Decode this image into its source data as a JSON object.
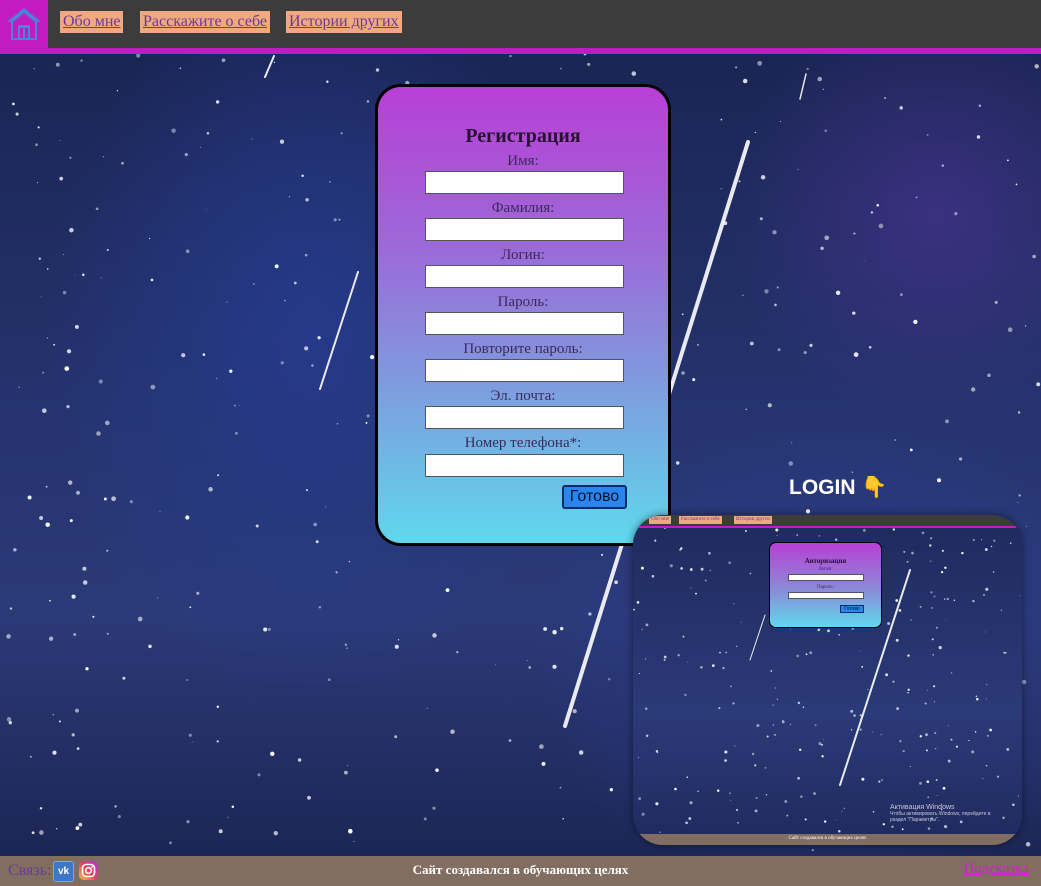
{
  "header": {
    "home_icon": "home-icon",
    "nav": [
      {
        "label": "Обо мне"
      },
      {
        "label": "Расскажите о себе"
      },
      {
        "label": "Истории других"
      }
    ],
    "accent_color": "#c21bc2"
  },
  "form": {
    "title": "Регистрация",
    "fields": [
      {
        "label": "Имя:",
        "value": ""
      },
      {
        "label": "Фамилия:",
        "value": ""
      },
      {
        "label": "Логин:",
        "value": ""
      },
      {
        "label": "Пароль:",
        "value": ""
      },
      {
        "label": "Повторите пароль:",
        "value": ""
      },
      {
        "label": "Эл. почта:",
        "value": ""
      },
      {
        "label": "Номер телефона*:",
        "value": ""
      }
    ],
    "submit_label": "Готово"
  },
  "footer": {
    "contact_label": "Связь:",
    "vk_label": "vk",
    "vk_icon": "vk-icon",
    "instagram_icon": "instagram-icon",
    "note": "Сайт создавался в обучающих целях",
    "link_label": "Подсказка"
  },
  "preview": {
    "caption": "LOGIN 👇",
    "nav": [
      "Обо мне",
      "Расскажите о себе",
      "Истории других"
    ],
    "card_title": "Авторизация",
    "fields": [
      "Логин:",
      "Пароль:"
    ],
    "submit_label": "Готово",
    "footer_note": "Сайт создавался в обучающих целях",
    "windows_title": "Активация Windows",
    "windows_sub1": "Чтобы активировать Windows, перейдите в",
    "windows_sub2": "раздел \"Параметры\"."
  }
}
